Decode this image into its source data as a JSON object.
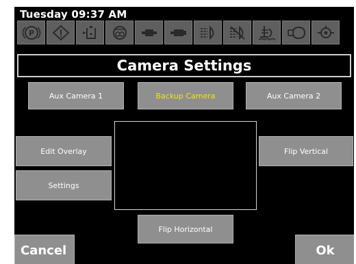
{
  "status": {
    "datetime": "Tuesday 09:37 AM"
  },
  "icons": [
    "parking-brake-icon",
    "warning-diamond-icon",
    "fluid-drain-icon",
    "transmission-filter-icon",
    "drive-engaged-icon",
    "pto-icon",
    "headlight-dim-icon",
    "headlight-off-icon",
    "wading-depth-icon",
    "air-pressure-icon",
    "rotating-beacon-icon"
  ],
  "title": "Camera Settings",
  "buttons": {
    "aux_camera_1": "Aux Camera 1",
    "backup_camera": "Backup Camera",
    "aux_camera_2": "Aux Camera 2",
    "edit_overlay": "Edit Overlay",
    "settings": "Settings",
    "flip_vertical": "Flip Vertical",
    "flip_horizontal": "Flip Horizontal",
    "cancel": "Cancel",
    "ok": "Ok"
  },
  "colors": {
    "selected_text": "#f2e600",
    "button_bg": "#8f8f8f",
    "background": "#000000"
  }
}
